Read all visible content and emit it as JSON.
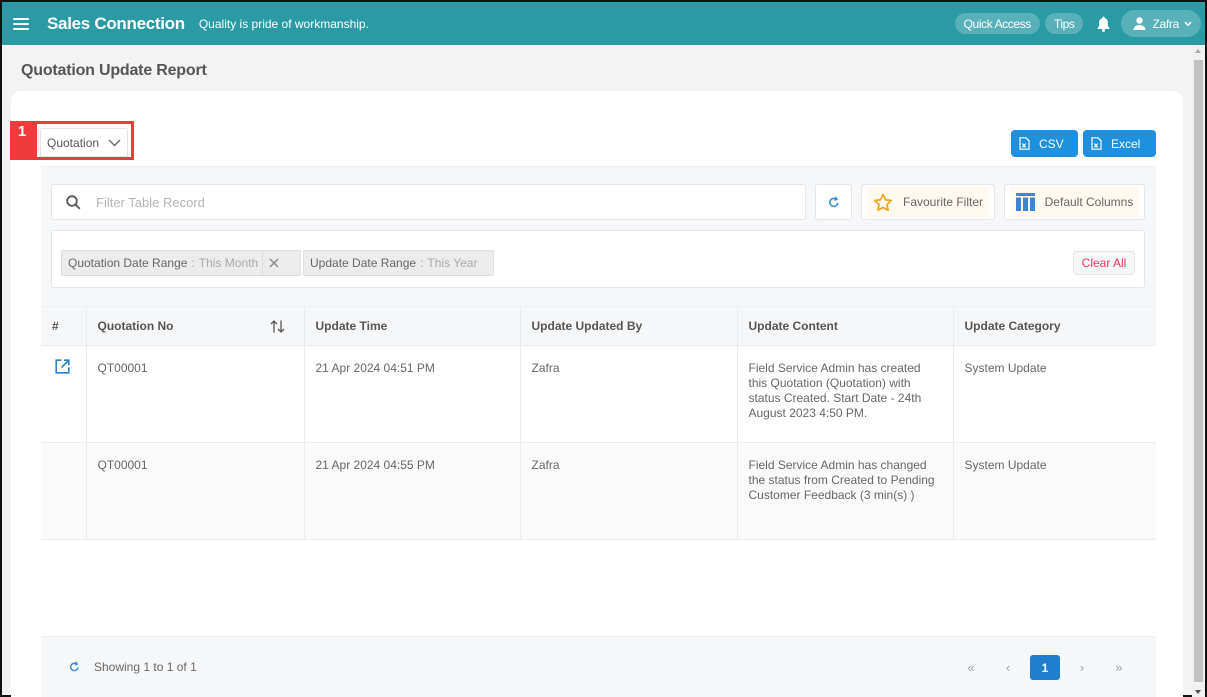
{
  "topbar": {
    "brand": "Sales Connection",
    "tagline": "Quality is pride of workmanship.",
    "quick_access": "Quick Access",
    "tips": "Tips",
    "user_name": "Zafra"
  },
  "page": {
    "title": "Quotation Update Report",
    "marker_number": "1",
    "module_select": "Quotation"
  },
  "export": {
    "csv": "CSV",
    "excel": "Excel"
  },
  "filter": {
    "search_placeholder": "Filter Table Record",
    "search_value": "",
    "favourite": "Favourite Filter",
    "columns": "Default Columns",
    "chips": [
      {
        "key": "Quotation Date Range",
        "value": "This Month"
      },
      {
        "key": "Update Date Range",
        "value": "This Year"
      }
    ],
    "clear_all": "Clear All"
  },
  "table": {
    "headers": [
      "#",
      "Quotation No",
      "Update Time",
      "Update Updated By",
      "Update Content",
      "Update Category"
    ],
    "rows": [
      {
        "quotation_no": "QT00001",
        "update_time": "21 Apr 2024 04:51 PM",
        "updated_by": "Zafra",
        "content": "Field Service Admin has created this Quotation (Quotation) with status Created. Start Date - 24th August 2023 4:50 PM.",
        "category": "System Update"
      },
      {
        "quotation_no": "QT00001",
        "update_time": "21 Apr 2024 04:55 PM",
        "updated_by": "Zafra",
        "content": "Field Service Admin has changed the status from Created to Pending Customer Feedback (3 min(s) )",
        "category": "System Update"
      }
    ]
  },
  "footer": {
    "showing": "Showing 1 to 1 of 1",
    "current_page": "1",
    "first": "«",
    "prev": "‹",
    "next": "›",
    "last": "»"
  },
  "colors": {
    "topbar": "#2a9aa4",
    "primary": "#1e90e0",
    "marker": "#ef3b3b",
    "clear_all": "#e8395a"
  }
}
